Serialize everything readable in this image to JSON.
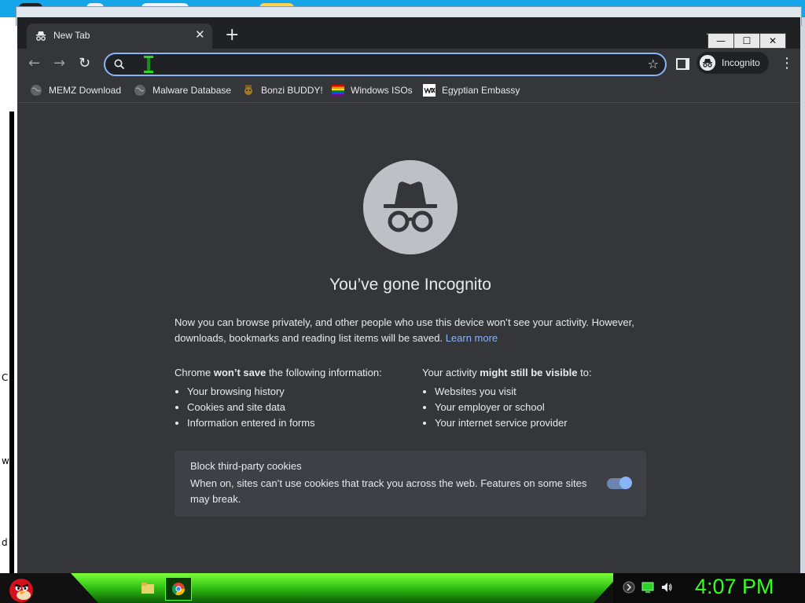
{
  "window_controls": {
    "minimize": "—",
    "maximize": "☐",
    "close": "✕"
  },
  "tab": {
    "title": "New Tab",
    "close": "✕"
  },
  "tabstrip": {
    "new_tab": "+",
    "tab_search": "⌄"
  },
  "toolbar": {
    "back": "←",
    "forward": "→",
    "reload": "↻",
    "omnibox_value": "",
    "bookmark_star": "☆",
    "profile_label": "Incognito",
    "menu": "⋮"
  },
  "bookmarks": [
    {
      "label": "MEMZ Download",
      "icon": "globe-icon"
    },
    {
      "label": "Malware Database",
      "icon": "globe-icon"
    },
    {
      "label": "Bonzi BUDDY!",
      "icon": "bonzi-icon"
    },
    {
      "label": "Windows ISOs",
      "icon": "rainbow-flag-icon"
    },
    {
      "label": "Egyptian Embassy",
      "icon": "wix-icon"
    }
  ],
  "incognito": {
    "headline": "You’ve gone Incognito",
    "intro": "Now you can browse privately, and other people who use this device won’t see your activity. However, downloads, bookmarks and reading list items will be saved.",
    "learn_more": "Learn more",
    "left_heading_pre": "Chrome ",
    "left_heading_bold": "won’t save",
    "left_heading_post": " the following information:",
    "left_items": [
      "Your browsing history",
      "Cookies and site data",
      "Information entered in forms"
    ],
    "right_heading_pre": "Your activity ",
    "right_heading_bold": "might still be visible",
    "right_heading_post": " to:",
    "right_items": [
      "Websites you visit",
      "Your employer or school",
      "Your internet service provider"
    ],
    "cookie_title": "Block third-party cookies",
    "cookie_desc": "When on, sites can’t use cookies that track you across the web. Features on some sites may break.",
    "cookie_toggle_on": true
  },
  "taskbar": {
    "clock": "4:07 PM"
  },
  "desktop": {
    "left_letters": [
      "C",
      "w",
      "d"
    ]
  },
  "colors": {
    "accent": "#8ab4f8",
    "page_bg": "#35363a",
    "clock": "#34ff1e"
  }
}
